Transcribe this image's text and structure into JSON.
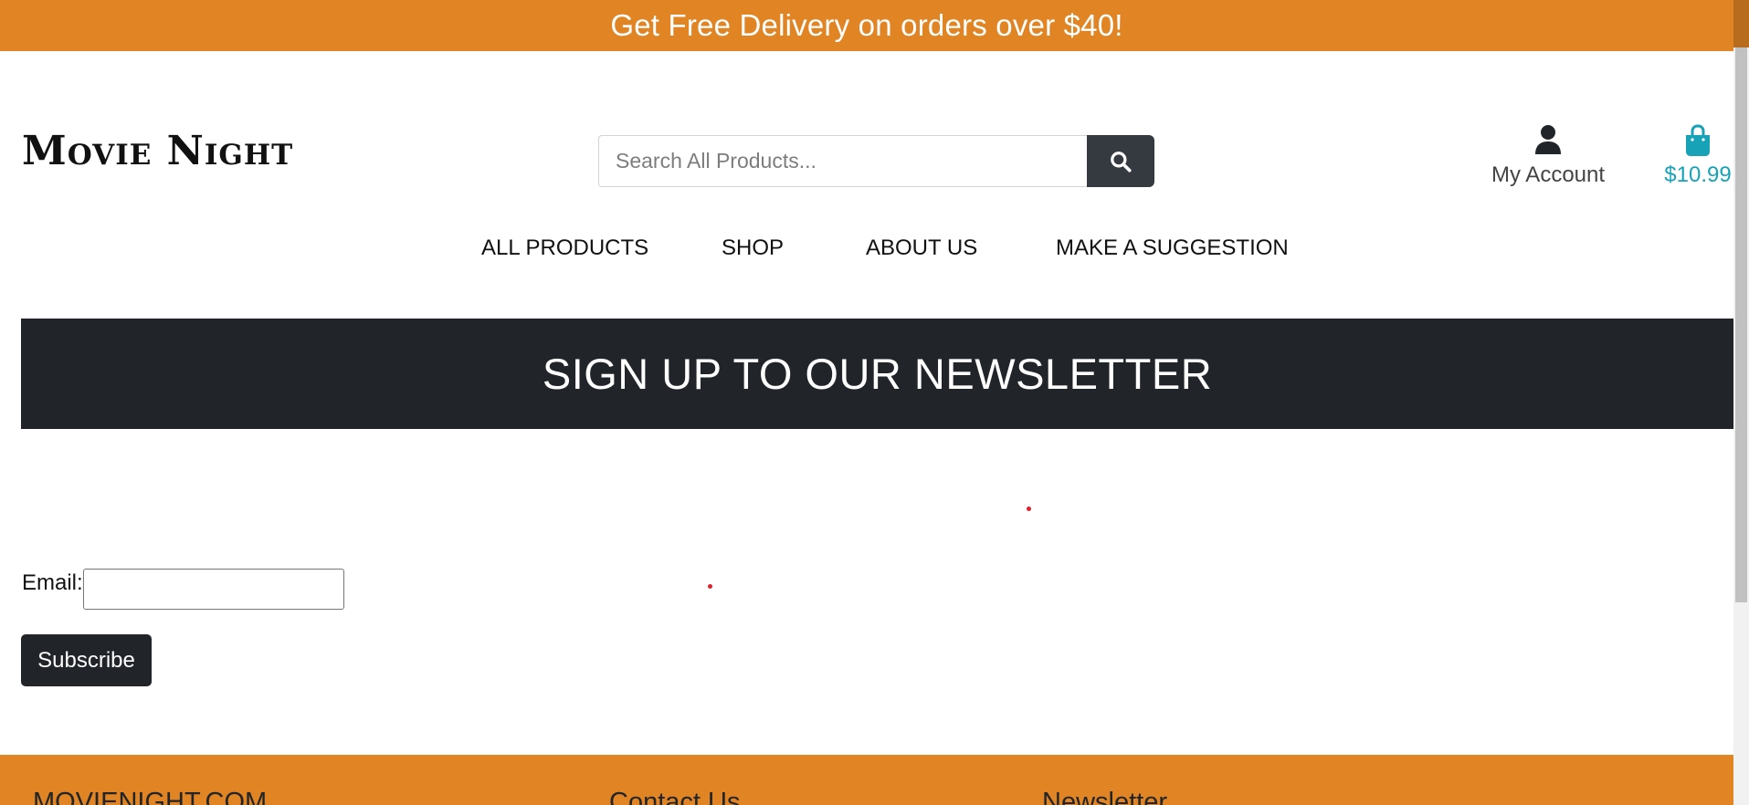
{
  "banner": {
    "text": "Get Free Delivery on orders over $40!"
  },
  "header": {
    "logo": "Movie Night",
    "search": {
      "placeholder": "Search All Products...",
      "icon": "search-icon"
    },
    "account": {
      "label": "My Account",
      "icon": "user-icon"
    },
    "bag": {
      "total": "$10.99",
      "icon": "shopping-bag-icon"
    }
  },
  "nav": {
    "items": [
      {
        "label": "ALL PRODUCTS"
      },
      {
        "label": "SHOP"
      },
      {
        "label": "ABOUT US"
      },
      {
        "label": "MAKE A SUGGESTION"
      }
    ]
  },
  "newsletter": {
    "heading": "SIGN UP TO OUR NEWSLETTER",
    "email_label": "Email:",
    "email_value": "",
    "subscribe_label": "Subscribe"
  },
  "footer": {
    "columns": [
      {
        "heading": "MOVIENIGHT.COM"
      },
      {
        "heading": "Contact Us"
      },
      {
        "heading": "Newsletter"
      }
    ]
  },
  "colors": {
    "accent": "#e08424",
    "dark": "#212529",
    "bag": "#17a2b8"
  }
}
